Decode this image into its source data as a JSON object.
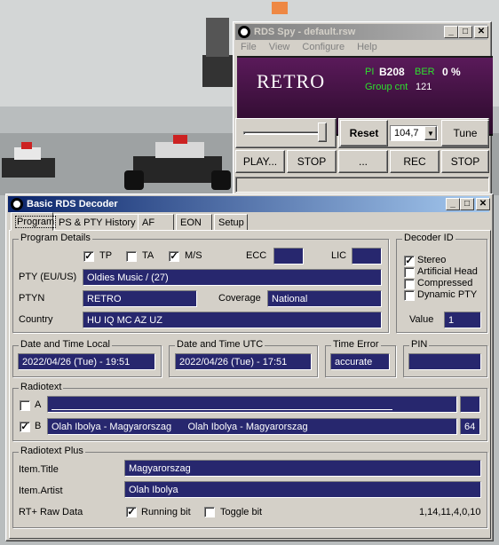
{
  "colors": {
    "field_bg": "#27276e",
    "display_bg": "#3d0f3d",
    "accent_green": "#2ee02e",
    "title_active": "#0a246a"
  },
  "rds_spy": {
    "title": "RDS Spy - default.rsw",
    "menu": [
      "File",
      "View",
      "Configure",
      "Help"
    ],
    "ps": "RETRO",
    "pi_label": "PI",
    "pi_value": "B208",
    "ber_label": "BER",
    "ber_value": "0 %",
    "group_cnt_label": "Group cnt",
    "group_cnt_value": "121",
    "reset_label": "Reset",
    "frequency": "104,7",
    "tune_label": "Tune",
    "play_label": "PLAY...",
    "stop_label": "STOP",
    "dots_label": "...",
    "rec_label": "REC",
    "stop2_label": "STOP",
    "slider_level": 0.95
  },
  "decoder": {
    "title": "Basic RDS Decoder",
    "tabs": [
      "Program",
      "PS & PTY History",
      "AF",
      "EON",
      "Setup"
    ],
    "program_details_title": "Program Details",
    "tp_label": "TP",
    "ta_label": "TA",
    "ms_label": "M/S",
    "ecc_label": "ECC",
    "lic_label": "LIC",
    "pty_label": "PTY (EU/US)",
    "pty_value": "Oldies Music /  (27)",
    "ptyn_label": "PTYN",
    "ptyn_value": "RETRO",
    "coverage_label": "Coverage",
    "coverage_value": "National",
    "country_label": "Country",
    "country_value": "HU IQ MC AZ UZ",
    "decoder_id_title": "Decoder ID",
    "stereo_label": "Stereo",
    "artificial_head_label": "Artificial Head",
    "compressed_label": "Compressed",
    "dynamic_pty_label": "Dynamic PTY",
    "value_label": "Value",
    "value_value": "1",
    "dt_local_title": "Date and Time Local",
    "dt_local_value": "2022/04/26 (Tue) - 19:51",
    "dt_utc_title": "Date and Time UTC",
    "dt_utc_value": "2022/04/26 (Tue) - 17:51",
    "time_error_title": "Time Error",
    "time_error_value": "accurate",
    "pin_title": "PIN",
    "radiotext_title": "Radiotext",
    "rt_a_label": "A",
    "rt_b_label": "B",
    "rt_b_value": "Olah Ibolya - Magyarorszag      Olah Ibolya - Magyarorszag",
    "rt_b_count": "64",
    "rtplus_title": "Radiotext Plus",
    "item_title_label": "Item.Title",
    "item_title_value": "Magyarorszag",
    "item_artist_label": "Item.Artist",
    "item_artist_value": "Olah Ibolya",
    "rt_raw_label": "RT+ Raw Data",
    "running_bit_label": "Running bit",
    "toggle_bit_label": "Toggle bit",
    "raw_value": "1,14,11,4,0,10"
  }
}
